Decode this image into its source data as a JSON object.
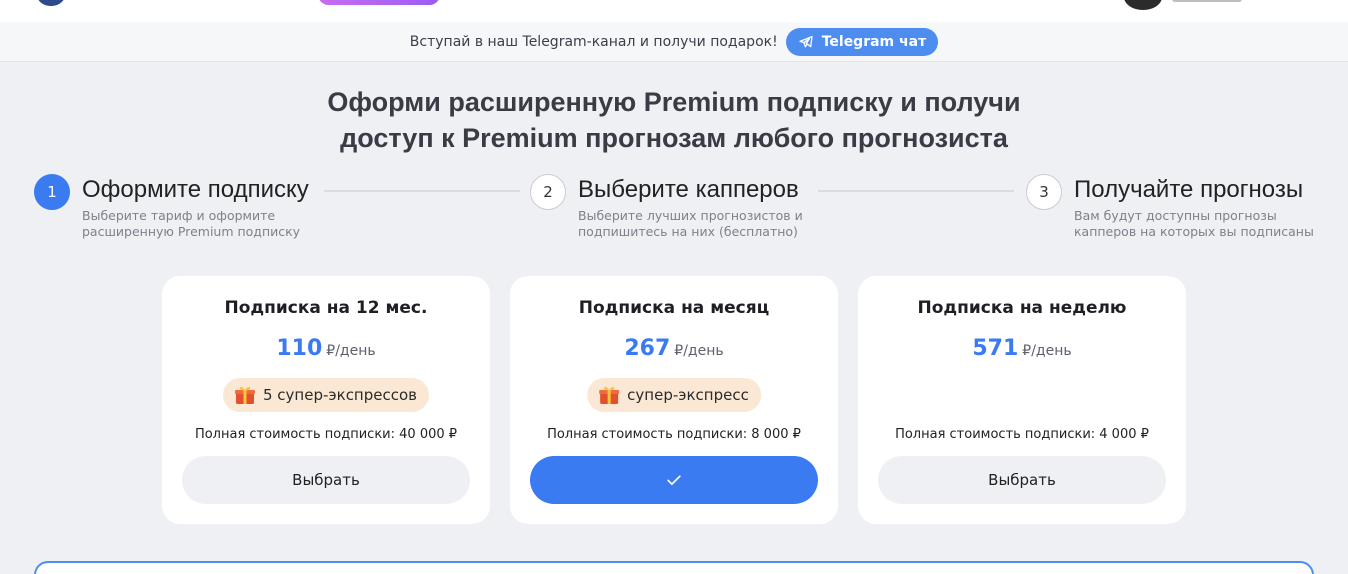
{
  "banner": {
    "text": "Вступай в наш Telegram-канал и получи подарок!",
    "button_label": "Telegram чат"
  },
  "heading": {
    "line1": "Оформи расширенную Premium подписку и получи",
    "line2": "доступ к Premium прогнозам любого прогнозиста"
  },
  "steps": [
    {
      "number": "1",
      "title": "Оформите подписку",
      "description": "Выберите тариф и оформите расширенную Premium подписку",
      "active": true
    },
    {
      "number": "2",
      "title": "Выберите капперов",
      "description": "Выберите лучших прогнозистов и подпишитесь на них (бесплатно)",
      "active": false
    },
    {
      "number": "3",
      "title": "Получайте прогнозы",
      "description": "Вам будут доступны прогнозы капперов на которых вы подписаны",
      "active": false
    }
  ],
  "plans": [
    {
      "title": "Подписка на 12 мес.",
      "price": "110",
      "unit": "₽/день",
      "gift": "5 супер-экспрессов",
      "full_cost": "Полная стоимость подписки: 40 000 ₽",
      "button_label": "Выбрать",
      "selected": false
    },
    {
      "title": "Подписка на месяц",
      "price": "267",
      "unit": "₽/день",
      "gift": "супер-экспресс",
      "full_cost": "Полная стоимость подписки: 8 000 ₽",
      "button_label": "",
      "selected": true
    },
    {
      "title": "Подписка на неделю",
      "price": "571",
      "unit": "₽/день",
      "gift": "",
      "full_cost": "Полная стоимость подписки: 4 000 ₽",
      "button_label": "Выбрать",
      "selected": false
    }
  ],
  "icons": {
    "banner_button": "telegram-icon",
    "gift": "gift-icon",
    "selected": "checkmark-icon"
  },
  "colors": {
    "accent": "#3b7bf1",
    "telegram": "#4e8df0",
    "gift_bg": "#fbe8d4",
    "page_bg": "#eef0f4"
  }
}
